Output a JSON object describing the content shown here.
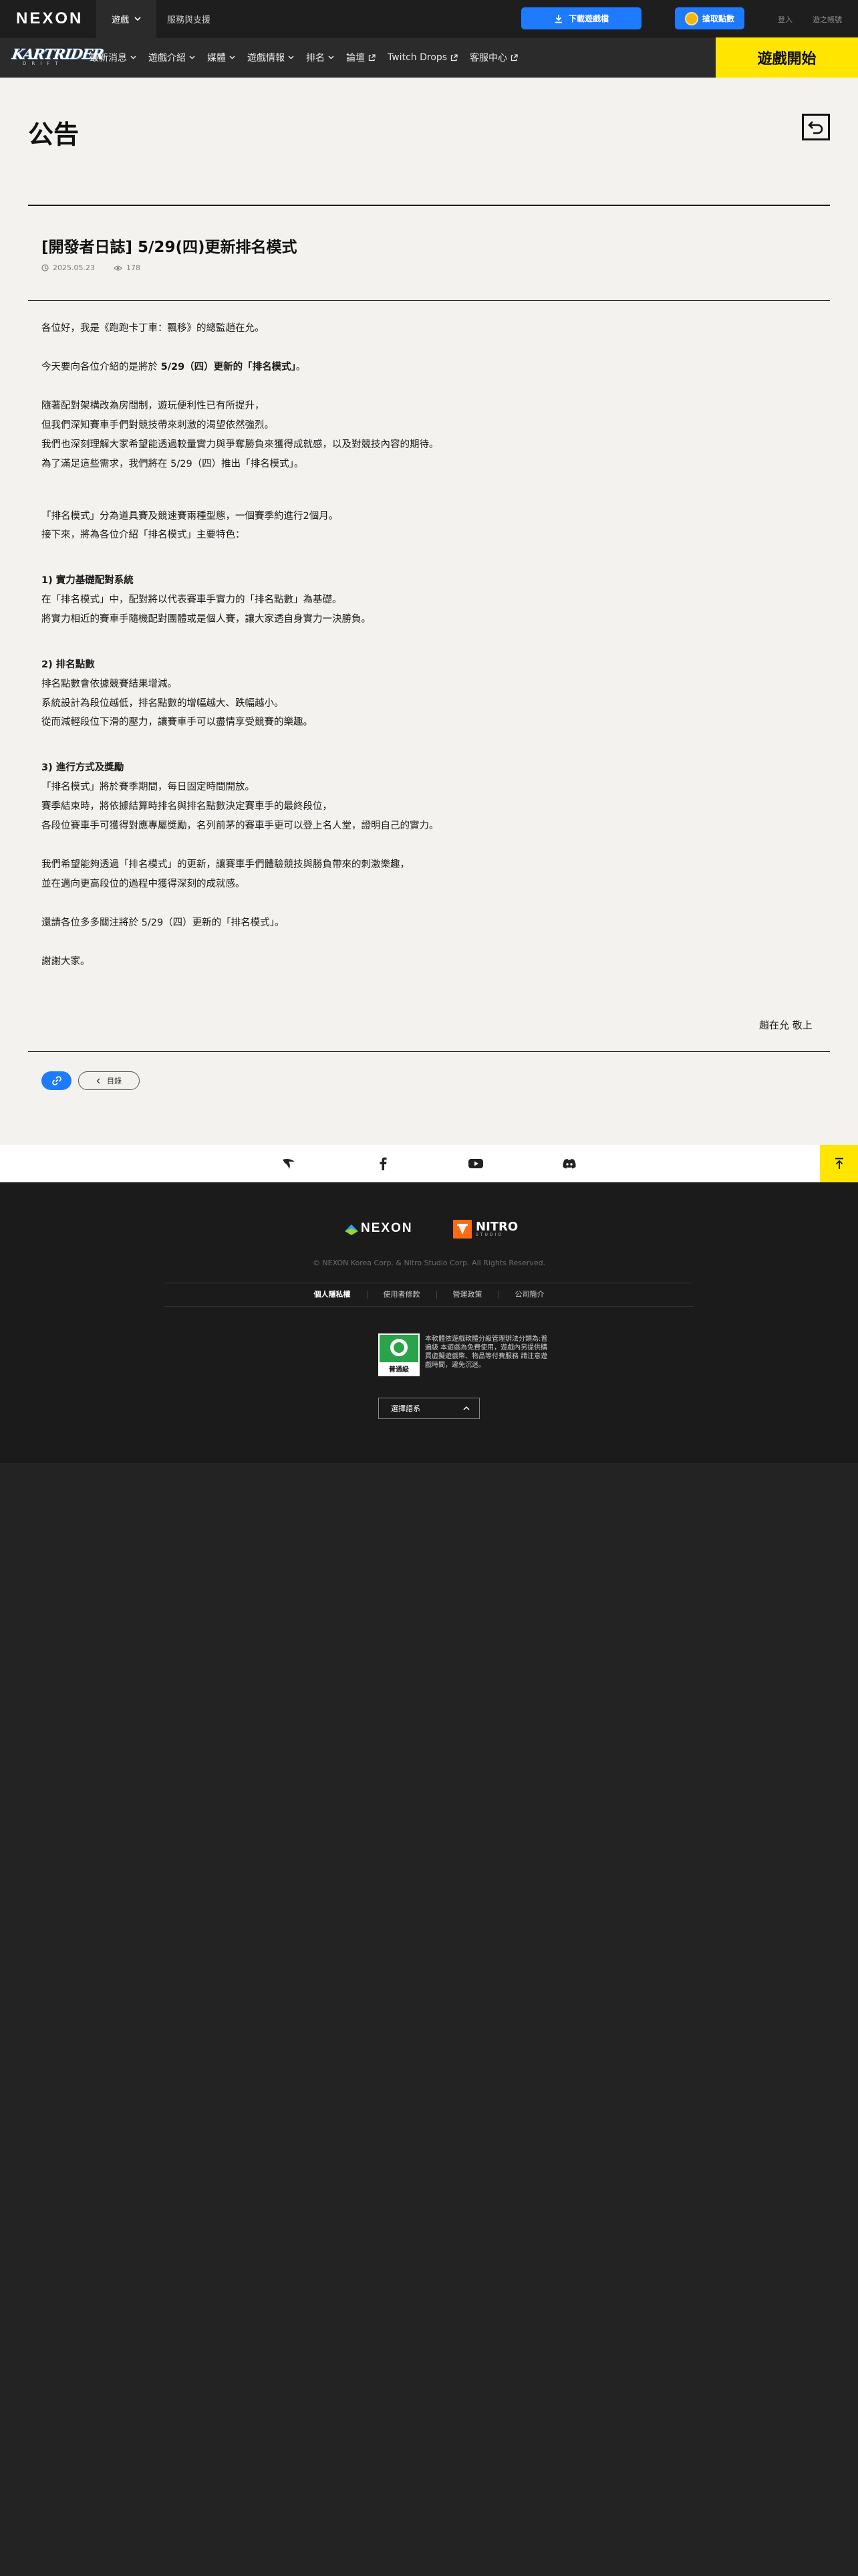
{
  "topbar": {
    "brand": "NEXON",
    "game_menu": "遊戲",
    "service_menu": "服務與支援",
    "download_label": "下載遊戲檔",
    "points_label": "搶取點數",
    "login_label": "登入",
    "signup_label": "遊之帳號"
  },
  "gamenav": {
    "logo_text": "KARTRIDER",
    "logo_sub": "DRIFT",
    "items": [
      {
        "label": "最新消息",
        "icon": "chevron-down-icon"
      },
      {
        "label": "遊戲介紹",
        "icon": "chevron-down-icon"
      },
      {
        "label": "媒體",
        "icon": "chevron-down-icon"
      },
      {
        "label": "遊戲情報",
        "icon": "chevron-down-icon"
      },
      {
        "label": "排名",
        "icon": "chevron-down-icon"
      },
      {
        "label": "論壇",
        "icon": "external-link-icon"
      },
      {
        "label": "Twitch Drops",
        "icon": "external-link-icon"
      },
      {
        "label": "客服中心",
        "icon": "external-link-icon"
      }
    ],
    "play_label": "遊戲開始"
  },
  "page": {
    "title": "公告"
  },
  "post": {
    "title": "[開發者日誌] 5/29(四)更新排名模式",
    "date": "2025.05.23",
    "views": "178",
    "body": {
      "p1": "各位好，我是《跑跑卡丁車：飄移》的總監趙在允。",
      "p2_pre": "今天要向各位介紹的是將於 ",
      "p2_bold": "5/29（四）更新的「排名模式」",
      "p2_post": "。",
      "p3": "隨著配對架構改為房間制，遊玩便利性已有所提升，",
      "p4": "但我們深知賽車手們對競技帶來刺激的渴望依然強烈。",
      "p5": "我們也深刻理解大家希望能透過較量實力與爭奪勝負來獲得成就感，以及對競技內容的期待。",
      "p6": "為了滿足這些需求，我們將在 5/29（四）推出「排名模式」。",
      "p7": "「排名模式」分為道具賽及競速賽兩種型態，一個賽季約進行2個月。",
      "p8": "接下來，將為各位介紹「排名模式」主要特色：",
      "h1": "1) 實力基礎配對系統",
      "p9": "在「排名模式」中，配對將以代表賽車手實力的「排名點數」為基礎。",
      "p10": "將實力相近的賽車手隨機配對團體或是個人賽，讓大家透自身實力一決勝負。",
      "h2": "2) 排名點數",
      "p11": "排名點數會依據競賽結果增減。",
      "p12": "系統設計為段位越低，排名點數的增幅越大、跌幅越小。",
      "p13": "從而減輕段位下滑的壓力，讓賽車手可以盡情享受競賽的樂趣。",
      "h3": "3) 進行方式及獎勵",
      "p14": "「排名模式」將於賽季期間，每日固定時間開放。",
      "p15": "賽季結束時，將依據結算時排名與排名點數決定賽車手的最終段位，",
      "p16": "各段位賽車手可獲得對應專屬獎勵，名列前茅的賽車手更可以登上名人堂，證明自己的實力。",
      "p17": "我們希望能夠透過「排名模式」的更新，讓賽車手們體驗競技與勝負帶來的刺激樂趣，",
      "p18": "並在邁向更高段位的過程中獲得深刻的成就感。",
      "p19": "還請各位多多關注將於 5/29（四）更新的「排名模式」。",
      "p20": "謝謝大家。"
    },
    "signature": "趙在允 敬上",
    "list_label": "目錄"
  },
  "social": {
    "icons": [
      "kartrider-icon",
      "facebook-icon",
      "youtube-icon",
      "discord-icon"
    ],
    "top_icon": "arrow-up-icon"
  },
  "footer": {
    "nexon": "NEXON",
    "nitro": "NITRO",
    "nitro_sub": "STUDIO",
    "copyright": "© NEXON Korea Corp. & Nitro Studio Corp. All Rights Reserved.",
    "links": [
      "個人隱私權",
      "使用者條款",
      "營運政策",
      "公司簡介"
    ],
    "rating_label": "普通級",
    "rating_text": "本軟體依遊戲軟體分級管理辦法分類為:普遍級 本遊戲為免費使用，遊戲內另提供購買虛擬遊戲幣、物品等付費服務 請注意遊戲時間，避免沉迷。",
    "language_label": "選擇語系"
  },
  "colors": {
    "accent_blue": "#1e7bff",
    "play_yellow": "#ffe500",
    "content_bg": "#f3f2ef",
    "dark_bg": "#232323"
  }
}
